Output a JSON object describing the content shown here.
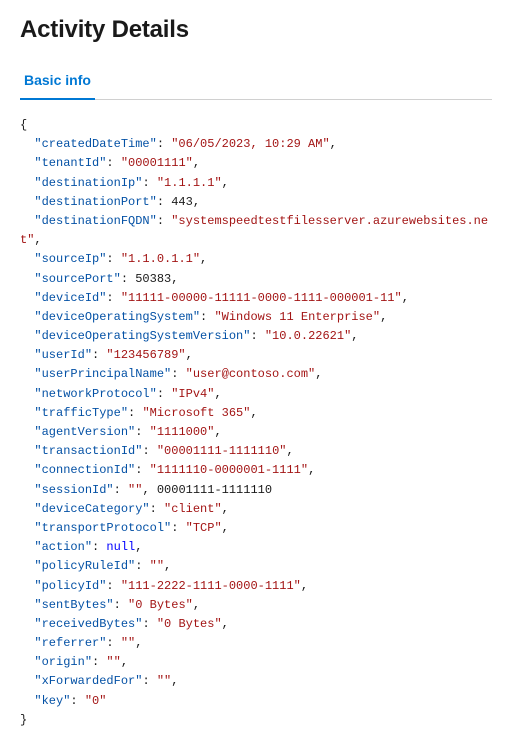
{
  "page": {
    "title": "Activity Details"
  },
  "tabs": [
    {
      "label": "Basic info",
      "active": true
    }
  ],
  "json_data": {
    "createdDateTime": "06/05/2023, 10:29 AM",
    "tenantId": "00001111",
    "destinationIp": "1.1.1.1",
    "destinationPort": "443",
    "destinationFQDN": "systemspeedtestfilesserver.azurewebsites.net",
    "sourceIp": "1.1.0.1.1",
    "sourcePort": "50383",
    "deviceId": "11111-00000-11111-0000-1111-000001-11",
    "deviceOperatingSystem": "Windows 11 Enterprise",
    "deviceOperatingSystemVersion": "10.0.22621",
    "userId": "123456789",
    "userPrincipalName": "user@contoso.com",
    "networkProtocol": "IPv4",
    "trafficType": "Microsoft 365",
    "agentVersion": "1111000",
    "transactionId": "00001111-1111110",
    "connectionId": "1111110-0000001-1111",
    "sessionId": "00001111-1111110",
    "deviceCategory": "client",
    "transportProtocol": "TCP",
    "action": "null",
    "policyRuleId": "",
    "policyId": "111-2222-1111-0000-1111",
    "sentBytes": "0 Bytes",
    "receivedBytes": "0 Bytes",
    "referrer": "",
    "origin": "",
    "xForwardedFor": "",
    "key": "0"
  }
}
